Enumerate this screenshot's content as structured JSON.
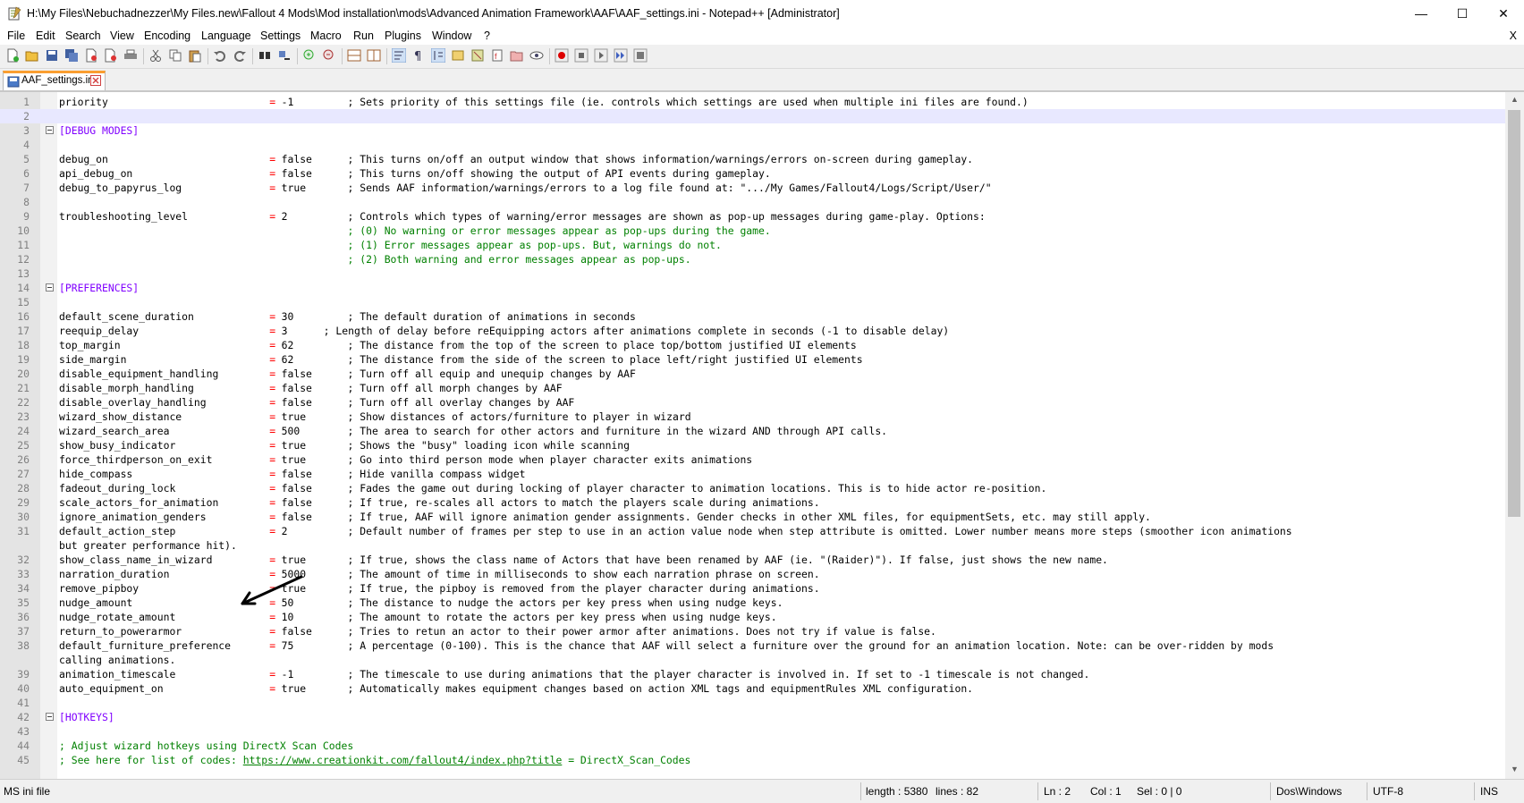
{
  "window": {
    "title": "H:\\My Files\\Nebuchadnezzer\\My Files.new\\Fallout 4 Mods\\Mod installation\\mods\\Advanced Animation Framework\\AAF\\AAF_settings.ini - Notepad++ [Administrator]",
    "minimize": "—",
    "maximize": "☐",
    "close": "✕"
  },
  "menu": {
    "items": [
      "File",
      "Edit",
      "Search",
      "View",
      "Encoding",
      "Language",
      "Settings",
      "Macro",
      "Run",
      "Plugins",
      "Window",
      "?"
    ],
    "close_doc": "X"
  },
  "tab": {
    "label": "AAF_settings.ini"
  },
  "editor": {
    "lines": [
      {
        "n": "1",
        "k": "priority",
        "e": "=",
        "v": "-1",
        "c": "; Sets priority of this settings file (ie. controls which settings are used when multiple ini files are found.)"
      },
      {
        "n": "2",
        "t": ""
      },
      {
        "n": "3",
        "s": "[DEBUG MODES]"
      },
      {
        "n": "4",
        "t": ""
      },
      {
        "n": "5",
        "k": "debug_on",
        "e": "=",
        "v": "false",
        "c": "; This turns on/off an output window that shows information/warnings/errors on-screen during gameplay."
      },
      {
        "n": "6",
        "k": "api_debug_on",
        "e": "=",
        "v": "false",
        "c": "; This turns on/off showing the output of API events during gameplay."
      },
      {
        "n": "7",
        "k": "debug_to_papyrus_log",
        "e": "=",
        "v": "true",
        "c": "; Sends AAF information/warnings/errors to a log file found at: \".../My Games/Fallout4/Logs/Script/User/\""
      },
      {
        "n": "8",
        "t": ""
      },
      {
        "n": "9",
        "k": "troubleshooting_level",
        "e": "=",
        "v": "2",
        "c": "; Controls which types of warning/error messages are shown as pop-up messages during game-play. Options:"
      },
      {
        "n": "10",
        "g": "; (0) No warning or error messages appear as pop-ups during the game."
      },
      {
        "n": "11",
        "g": "; (1) Error messages appear as pop-ups. But, warnings do not."
      },
      {
        "n": "12",
        "g": "; (2) Both warning and error messages appear as pop-ups."
      },
      {
        "n": "13",
        "t": ""
      },
      {
        "n": "14",
        "s": "[PREFERENCES]"
      },
      {
        "n": "15",
        "t": ""
      },
      {
        "n": "16",
        "k": "default_scene_duration",
        "e": "=",
        "v": "30",
        "c": "; The default duration of animations in seconds"
      },
      {
        "n": "17",
        "k": "reequip_delay",
        "e": "=",
        "v": "3",
        "c2": "; Length of delay before reEquipping actors after animations complete in seconds (-1 to disable delay)"
      },
      {
        "n": "18",
        "k": "top_margin",
        "e": "=",
        "v": "62",
        "c": "; The distance from the top of the screen to place top/bottom justified UI elements"
      },
      {
        "n": "19",
        "k": "side_margin",
        "e": "=",
        "v": "62",
        "c": "; The distance from the side of the screen to place left/right justified UI elements"
      },
      {
        "n": "20",
        "k": "disable_equipment_handling",
        "e": "=",
        "v": "false",
        "c": "; Turn off all equip and unequip changes by AAF"
      },
      {
        "n": "21",
        "k": "disable_morph_handling",
        "e": "=",
        "v": "false",
        "c": "; Turn off all morph changes by AAF"
      },
      {
        "n": "22",
        "k": "disable_overlay_handling",
        "e": "=",
        "v": "false",
        "c": "; Turn off all overlay changes by AAF"
      },
      {
        "n": "23",
        "k": "wizard_show_distance",
        "e": "=",
        "v": "true",
        "c": "; Show distances of actors/furniture to player in wizard"
      },
      {
        "n": "24",
        "k": "wizard_search_area",
        "e": "=",
        "v": "500",
        "c": "; The area to search for other actors and furniture in the wizard AND through API calls."
      },
      {
        "n": "25",
        "k": "show_busy_indicator",
        "e": "=",
        "v": "true",
        "c": "; Shows the \"busy\" loading icon while scanning"
      },
      {
        "n": "26",
        "k": "force_thirdperson_on_exit",
        "e": "=",
        "v": "true",
        "c": "; Go into third person mode when player character exits animations"
      },
      {
        "n": "27",
        "k": "hide_compass",
        "e": "=",
        "v": "false",
        "c": "; Hide vanilla compass widget"
      },
      {
        "n": "28",
        "k": "fadeout_during_lock",
        "e": "=",
        "v": "false",
        "c": "; Fades the game out during locking of player character to animation locations. This is to hide actor re-position."
      },
      {
        "n": "29",
        "k": "scale_actors_for_animation",
        "e": "=",
        "v": "false",
        "c": "; If true, re-scales all actors to match the players scale during animations."
      },
      {
        "n": "30",
        "k": "ignore_animation_genders",
        "e": "=",
        "v": "false",
        "c": "; If true, AAF will ignore animation gender assignments. Gender checks in other XML files, for equipmentSets, etc. may still apply."
      },
      {
        "n": "31",
        "k": "default_action_step",
        "e": "=",
        "v": "2",
        "c": "; Default number of frames per step to use in an action value node when step attribute is omitted. Lower number means more steps (smoother icon animations"
      },
      {
        "n": "",
        "w": "but greater performance hit)."
      },
      {
        "n": "32",
        "k": "show_class_name_in_wizard",
        "e": "=",
        "v": "true",
        "c": "; If true, shows the class name of Actors that have been renamed by AAF (ie. \"(Raider)\"). If false, just shows the new name."
      },
      {
        "n": "33",
        "k": "narration_duration",
        "e": "=",
        "v": "5000",
        "c": "; The amount of time in milliseconds to show each narration phrase on screen."
      },
      {
        "n": "34",
        "k": "remove_pipboy",
        "e": "=",
        "v": "true",
        "c": "; If true, the pipboy is removed from the player character during animations."
      },
      {
        "n": "35",
        "k": "nudge_amount",
        "e": "=",
        "v": "50",
        "c": "; The distance to nudge the actors per key press when using nudge keys."
      },
      {
        "n": "36",
        "k": "nudge_rotate_amount",
        "e": "=",
        "v": "10",
        "c": "; The amount to rotate the actors per key press when using nudge keys."
      },
      {
        "n": "37",
        "k": "return_to_powerarmor",
        "e": "=",
        "v": "false",
        "c": "; Tries to retun an actor to their power armor after animations. Does not try if value is false."
      },
      {
        "n": "38",
        "k": "default_furniture_preference",
        "e": "=",
        "v": "75",
        "c": "; A percentage (0-100). This is the chance that AAF will select a furniture over the ground for an animation location. Note: can be over-ridden by mods"
      },
      {
        "n": "",
        "w": "calling animations."
      },
      {
        "n": "39",
        "k": "animation_timescale",
        "e": "=",
        "v": "-1",
        "c": "; The timescale to use during animations that the player character is involved in. If set to -1 timescale is not changed."
      },
      {
        "n": "40",
        "k": "auto_equipment_on",
        "e": "=",
        "v": "true",
        "c": "; Automatically makes equipment changes based on action XML tags and equipmentRules XML configuration."
      },
      {
        "n": "41",
        "t": ""
      },
      {
        "n": "42",
        "s": "[HOTKEYS]"
      },
      {
        "n": "43",
        "t": ""
      },
      {
        "n": "44",
        "g": "; Adjust wizard hotkeys using DirectX Scan Codes",
        "gleft": true
      },
      {
        "n": "45",
        "g": "; See here for list of codes: ",
        "link": "https://www.creationkit.com/fallout4/index.php?title",
        "tail": " = DirectX_Scan_Codes",
        "gleft": true
      }
    ]
  },
  "status": {
    "filetype": "MS ini file",
    "length": "length : 5380",
    "lines": "lines : 82",
    "ln": "Ln : 2",
    "col": "Col : 1",
    "sel": "Sel : 0 | 0",
    "eol": "Dos\\Windows",
    "encoding": "UTF-8",
    "mode": "INS"
  }
}
